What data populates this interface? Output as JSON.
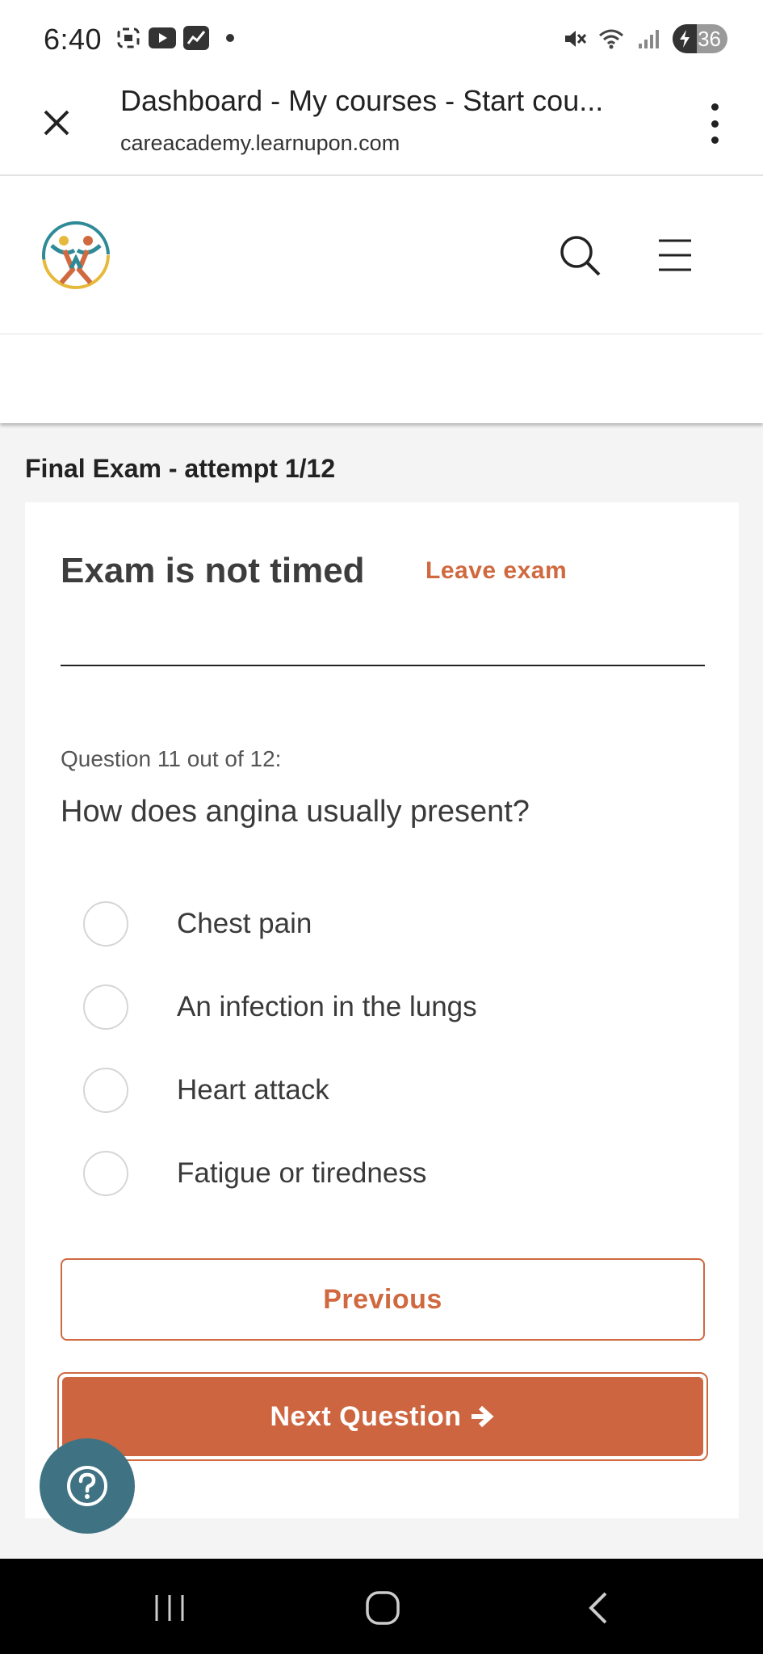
{
  "status_bar": {
    "time": "6:40",
    "left_icons": [
      "screenshot-icon",
      "youtube-icon",
      "activity-icon",
      "notification-dot-icon"
    ],
    "right_icons": [
      "mute-icon",
      "wifi-icon",
      "signal-icon"
    ],
    "battery": "36"
  },
  "browser": {
    "title": "Dashboard - My courses - Start cou...",
    "url": "careacademy.learnupon.com"
  },
  "exam": {
    "heading": "Final Exam - attempt 1/12",
    "timed_label": "Exam is not timed",
    "leave_label": "Leave exam",
    "question_number": "Question 11 out of 12:",
    "question_text": "How does angina usually present?",
    "options": [
      "Chest pain",
      "An infection in the lungs",
      "Heart attack",
      "Fatigue or tiredness"
    ],
    "previous_label": "Previous",
    "next_label": "Next Question"
  },
  "colors": {
    "accent": "#cd6640",
    "fab": "#3f7383"
  }
}
